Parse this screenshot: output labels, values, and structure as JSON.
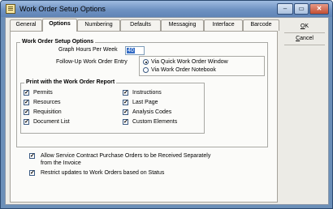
{
  "window": {
    "title": "Work Order Setup Options",
    "buttons": [
      "–",
      "▭",
      "✕"
    ]
  },
  "tabs": [
    "General",
    "Options",
    "Numbering",
    "Defaults",
    "Messaging",
    "Interface",
    "Barcode"
  ],
  "active_tab": "Options",
  "setup": {
    "group_title": "Work Order Setup Options",
    "hours_label": "Graph Hours Per Week",
    "hours_value": "40",
    "followup_label": "Follow-Up Work Order Entry",
    "followup_options": [
      {
        "label": "Via Quick Work Order Window",
        "selected": true
      },
      {
        "label": "Via Work Order Notebook",
        "selected": false
      }
    ]
  },
  "print": {
    "group_title": "Print with the Work Order Report",
    "items": [
      {
        "label": "Permits",
        "checked": true
      },
      {
        "label": "Resources",
        "checked": true
      },
      {
        "label": "Requisition",
        "checked": true
      },
      {
        "label": "Document List",
        "checked": true
      },
      {
        "label": "Instructions",
        "checked": true
      },
      {
        "label": "Last Page",
        "checked": true
      },
      {
        "label": "Analysis Codes",
        "checked": true
      },
      {
        "label": "Custom Elements",
        "checked": true
      }
    ]
  },
  "options": [
    {
      "label_line1": "Allow Service Contract Purchase Orders to be Received Separately",
      "label_line2": "from the Invoice",
      "checked": true
    },
    {
      "label_line1": "Restrict updates to Work Orders based on Status",
      "label_line2": "",
      "checked": true
    }
  ],
  "side_buttons": {
    "ok": {
      "accel": "O",
      "rest": "K"
    },
    "cancel": {
      "accel": "C",
      "rest": "ancel"
    }
  }
}
